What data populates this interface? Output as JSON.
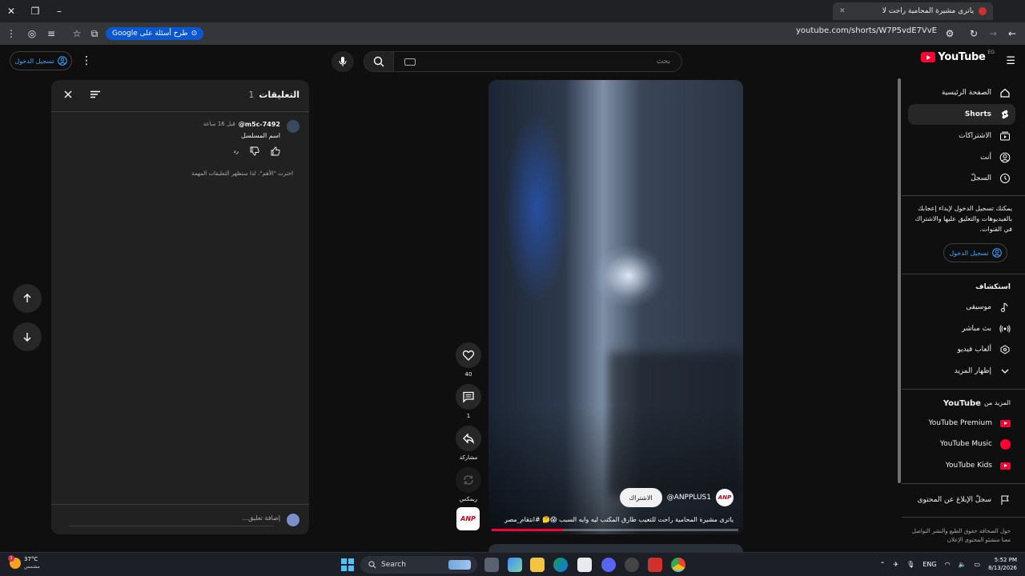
{
  "browser": {
    "tab_title": "ياترى مشيرة المحامية راحت لا",
    "url": "youtube.com/shorts/W7P5vdE7VvE",
    "google_pill": "طرح أسئلة على Google"
  },
  "header": {
    "logo_text": "YouTube",
    "logo_country": "EG",
    "search_placeholder": "بحث",
    "signin_label": "تسجيل الدخول"
  },
  "sidebar": {
    "items": [
      {
        "label": "الصفحة الرئيسية",
        "icon": "home-icon"
      },
      {
        "label": "Shorts",
        "icon": "shorts-icon",
        "active": true
      },
      {
        "label": "الاشتراكات",
        "icon": "subscriptions-icon"
      },
      {
        "label": "أنت",
        "icon": "you-icon"
      },
      {
        "label": "السجلّ",
        "icon": "history-icon"
      }
    ],
    "signin_prompt": "يمكنك تسجيل الدخول لإبداء إعجابك بالفيديوهات والتعليق عليها والاشتراك في القنوات.",
    "signin_label": "تسجيل الدخول",
    "explore_heading": "استكشاف",
    "explore": [
      {
        "label": "موسيقى",
        "icon": "music-icon"
      },
      {
        "label": "بث مباشر",
        "icon": "live-icon"
      },
      {
        "label": "ألعاب فيديو",
        "icon": "gaming-icon"
      },
      {
        "label": "إظهار المزيد",
        "icon": "chevron-down-icon"
      }
    ],
    "more_heading_prefix": "المزيد من",
    "more_heading_brand": "YouTube",
    "more": [
      {
        "label": "YouTube Premium"
      },
      {
        "label": "YouTube Music"
      },
      {
        "label": "YouTube Kids"
      }
    ],
    "report_label": "سجلّ الإبلاغ عن المحتوى",
    "footer": "حول الصحافة حقوق الطبع والنشر التواصل معنا منشئو المحتوى الإعلان"
  },
  "video": {
    "channel_name": "@ANPPLUS1",
    "channel_logo": "ANP",
    "subscribe_label": "الاشتراك",
    "title": "ياترى مشيرة المحامية راحت للتعيب طارق المكتب ليه وايه السبب 😱🤔 #انتقام_مصر",
    "progress": 0.29
  },
  "actions": {
    "likes": "40",
    "comments": "1",
    "share": "مشاركة",
    "remix": "ريمكس"
  },
  "comments_panel": {
    "title": "التعليقات",
    "count": "1",
    "comment": {
      "author": "@m5c-7492",
      "time": "قبل 16 ساعة",
      "text": "اسم المسلسل",
      "reply": "رد"
    },
    "note": "اخترت \"الأهم\"، لذا ستظهر التعليقات المهمة",
    "add_placeholder": "إضافة تعليق..."
  },
  "taskbar": {
    "temp": "37°C",
    "weather": "مشمس",
    "search": "Search",
    "lang": "ENG",
    "time": "5:52 PM",
    "date": "8/13/2026",
    "badge": "1"
  }
}
